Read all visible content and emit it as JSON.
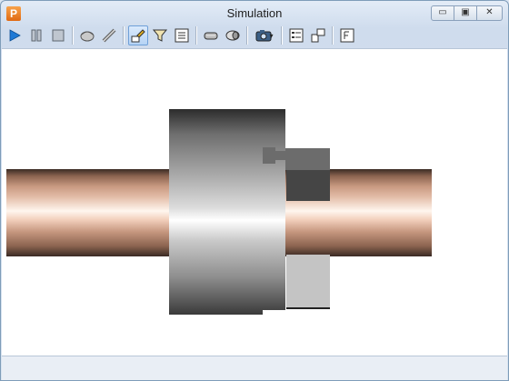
{
  "window": {
    "title": "Simulation",
    "app_icon_letter": "P",
    "minimize_glyph": "▭",
    "maximize_glyph": "▣",
    "close_glyph": "✕"
  },
  "toolbar": {
    "buttons": [
      {
        "name": "play",
        "icon": "play-icon"
      },
      {
        "name": "pause",
        "icon": "pause-icon"
      },
      {
        "name": "stop",
        "icon": "stop-icon"
      },
      {
        "name": "stock",
        "icon": "stock-icon"
      },
      {
        "name": "tool",
        "icon": "tool-icon"
      },
      {
        "name": "machine",
        "icon": "machine-icon",
        "active": true
      },
      {
        "name": "filter",
        "icon": "filter-icon"
      },
      {
        "name": "report",
        "icon": "report-icon"
      },
      {
        "name": "view-side",
        "icon": "cylinder-icon"
      },
      {
        "name": "view-section",
        "icon": "section-icon"
      },
      {
        "name": "camera",
        "icon": "camera-icon",
        "dropdown": true
      },
      {
        "name": "settings",
        "icon": "settings-list-icon"
      },
      {
        "name": "transform",
        "icon": "transform-icon"
      },
      {
        "name": "export",
        "icon": "export-icon"
      }
    ],
    "dropdown_glyph": "▾"
  },
  "colors": {
    "accent": "#6fa0d8",
    "play_blue": "#1f7ad6",
    "shaft_copper": "#e3bda8",
    "chuck_gray": "#a9a9a9",
    "tool_gray": "#6c6c6c"
  }
}
